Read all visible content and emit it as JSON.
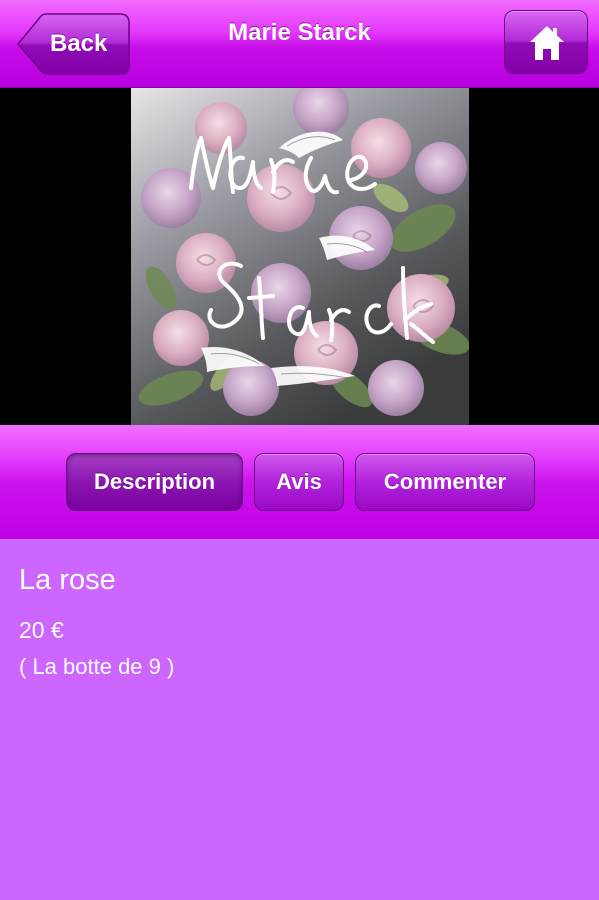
{
  "header": {
    "title": "Marie Starck",
    "back_label": "Back",
    "home_icon": "home-icon"
  },
  "image": {
    "logo_text_line1": "Marie",
    "logo_text_line2": "Starck"
  },
  "tabs": [
    {
      "label": "Description",
      "active": true
    },
    {
      "label": "Avis",
      "active": false
    },
    {
      "label": "Commenter",
      "active": false
    }
  ],
  "product": {
    "name": "La rose",
    "price": "20 €",
    "unit": "( La botte de 9 )"
  },
  "colors": {
    "accent": "#cc66ff",
    "nav": "#c60ce8",
    "dark_button": "#7a00a0"
  }
}
